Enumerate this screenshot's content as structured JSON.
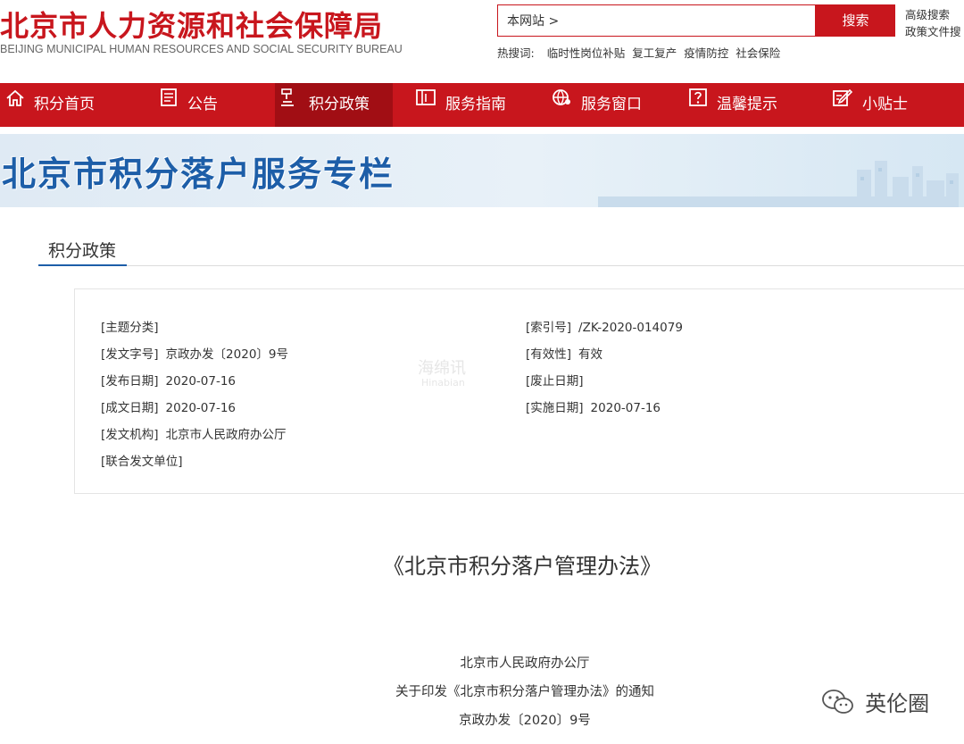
{
  "header": {
    "title_cn": "北京市人力资源和社会保障局",
    "title_en": "BEIJING MUNICIPAL HUMAN RESOURCES AND SOCIAL SECURITY BUREAU",
    "search_scope": "本网站 >",
    "search_button": "搜索",
    "advanced_search": "高级搜索",
    "policy_search": "政策文件搜",
    "hot_label": "热搜词:",
    "hot_words": [
      "临时性岗位补贴",
      "复工复产",
      "疫情防控",
      "社会保险"
    ]
  },
  "nav": {
    "items": [
      {
        "label": "积分首页",
        "icon": "home-icon"
      },
      {
        "label": "公告",
        "icon": "notice-icon"
      },
      {
        "label": "积分政策",
        "icon": "gavel-icon",
        "active": true
      },
      {
        "label": "服务指南",
        "icon": "guide-icon"
      },
      {
        "label": "服务窗口",
        "icon": "globe-icon"
      },
      {
        "label": "温馨提示",
        "icon": "question-icon"
      },
      {
        "label": "小贴士",
        "icon": "edit-icon"
      }
    ]
  },
  "banner": {
    "title": "北京市积分落户服务专栏"
  },
  "section": {
    "tab": "积分政策"
  },
  "meta": {
    "left": [
      {
        "key": "[主题分类]",
        "value": ""
      },
      {
        "key": "[发文字号]",
        "value": "京政办发〔2020〕9号"
      },
      {
        "key": "[发布日期]",
        "value": "2020-07-16"
      },
      {
        "key": "[成文日期]",
        "value": "2020-07-16"
      },
      {
        "key": "[发文机构]",
        "value": "北京市人民政府办公厅"
      },
      {
        "key": "[联合发文单位]",
        "value": ""
      }
    ],
    "right": [
      {
        "key": "[索引号]",
        "value": "/ZK-2020-014079"
      },
      {
        "key": "[有效性]",
        "value": "有效"
      },
      {
        "key": "[废止日期]",
        "value": ""
      },
      {
        "key": "[实施日期]",
        "value": "2020-07-16"
      }
    ],
    "watermark": "海绵讯",
    "watermark_sub": "Hinabian"
  },
  "document": {
    "title": "《北京市积分落户管理办法》",
    "lines": [
      "北京市人民政府办公厅",
      "关于印发《北京市积分落户管理办法》的通知",
      "京政办发〔2020〕9号"
    ]
  },
  "brand": {
    "name": "英伦圈",
    "icon": "wechat-icon"
  },
  "colors": {
    "primary_red": "#c8161d",
    "active_red": "#a10e14",
    "banner_blue": "#1d5ea8"
  }
}
